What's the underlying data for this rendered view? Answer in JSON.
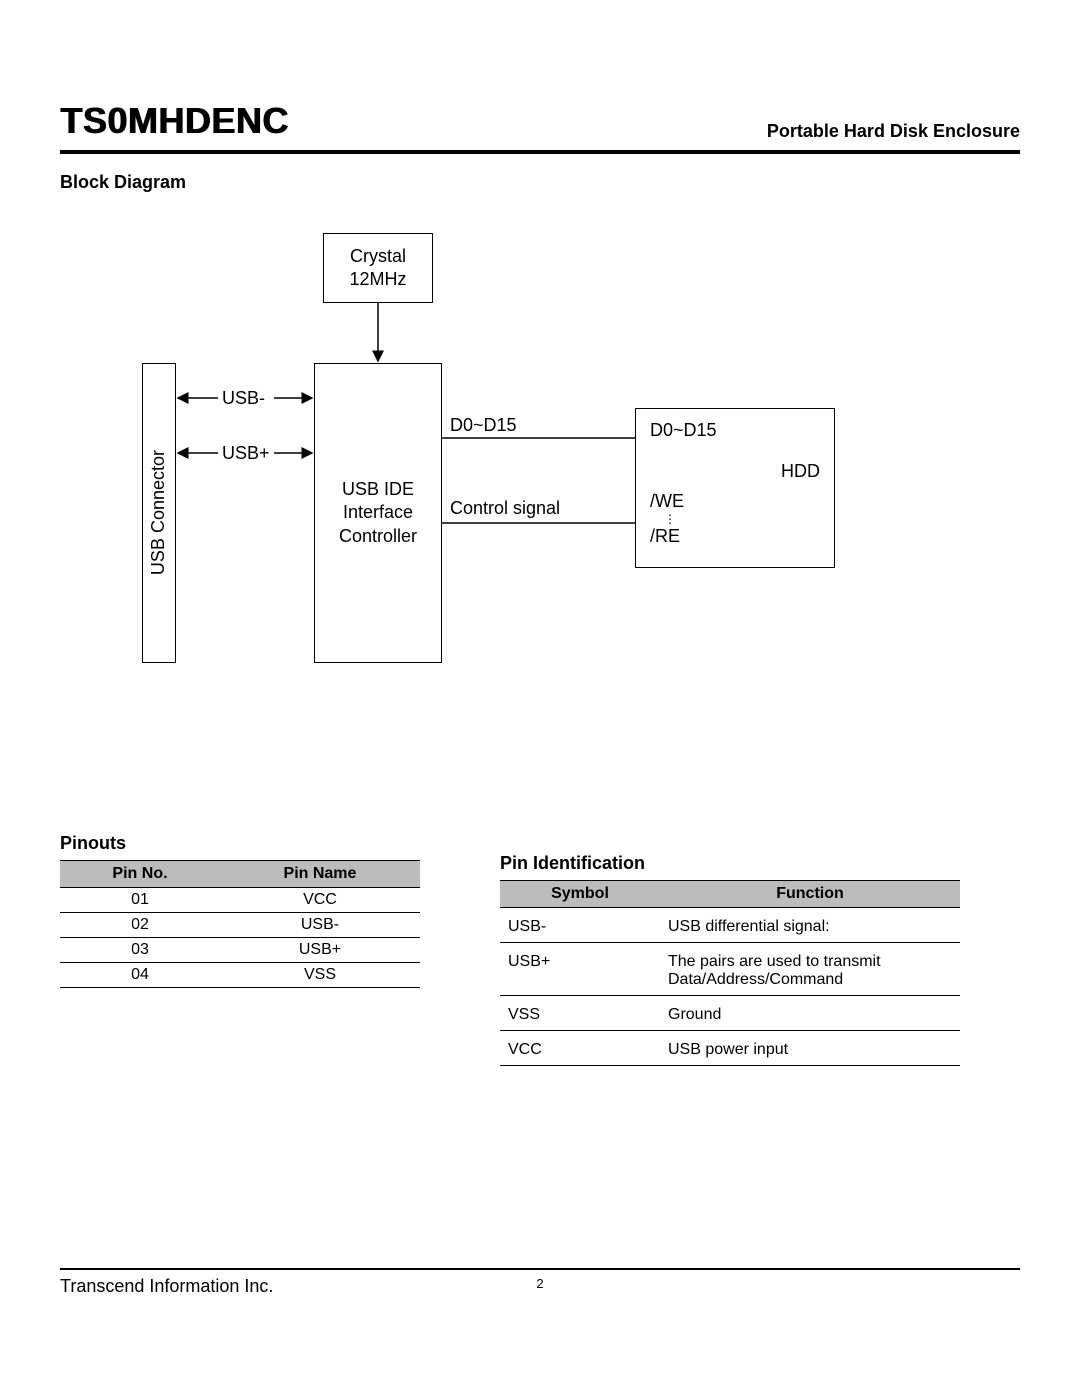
{
  "header": {
    "title": "TS0MHDENC",
    "subtitle": "Portable Hard Disk Enclosure"
  },
  "sections": {
    "block_diagram": "Block Diagram",
    "pinouts": "Pinouts",
    "pin_identification": "Pin Identification"
  },
  "diagram": {
    "crystal": {
      "line1": "Crystal",
      "line2": "12MHz"
    },
    "usb_connector": "USB Connector",
    "controller": {
      "line1": "USB IDE",
      "line2": "Interface",
      "line3": "Controller"
    },
    "hdd": {
      "title": "HDD",
      "d0d15": "D0~D15",
      "we": "/WE",
      "re": "/RE",
      "dots": "⋮"
    },
    "labels": {
      "usb_minus": "USB-",
      "usb_plus": "USB+",
      "d0d15": "D0~D15",
      "control_signal": "Control signal"
    }
  },
  "pinouts_table": {
    "headers": [
      "Pin No.",
      "Pin Name"
    ],
    "rows": [
      [
        "01",
        "VCC"
      ],
      [
        "02",
        "USB-"
      ],
      [
        "03",
        "USB+"
      ],
      [
        "04",
        "VSS"
      ]
    ]
  },
  "pinid_table": {
    "headers": [
      "Symbol",
      "Function"
    ],
    "rows": [
      [
        "USB-",
        "USB differential signal:"
      ],
      [
        "USB+",
        "The pairs are used to transmit Data/Address/Command"
      ],
      [
        "VSS",
        "Ground"
      ],
      [
        "VCC",
        "USB power input"
      ]
    ]
  },
  "footer": {
    "company": "Transcend Information Inc.",
    "page": "2"
  }
}
